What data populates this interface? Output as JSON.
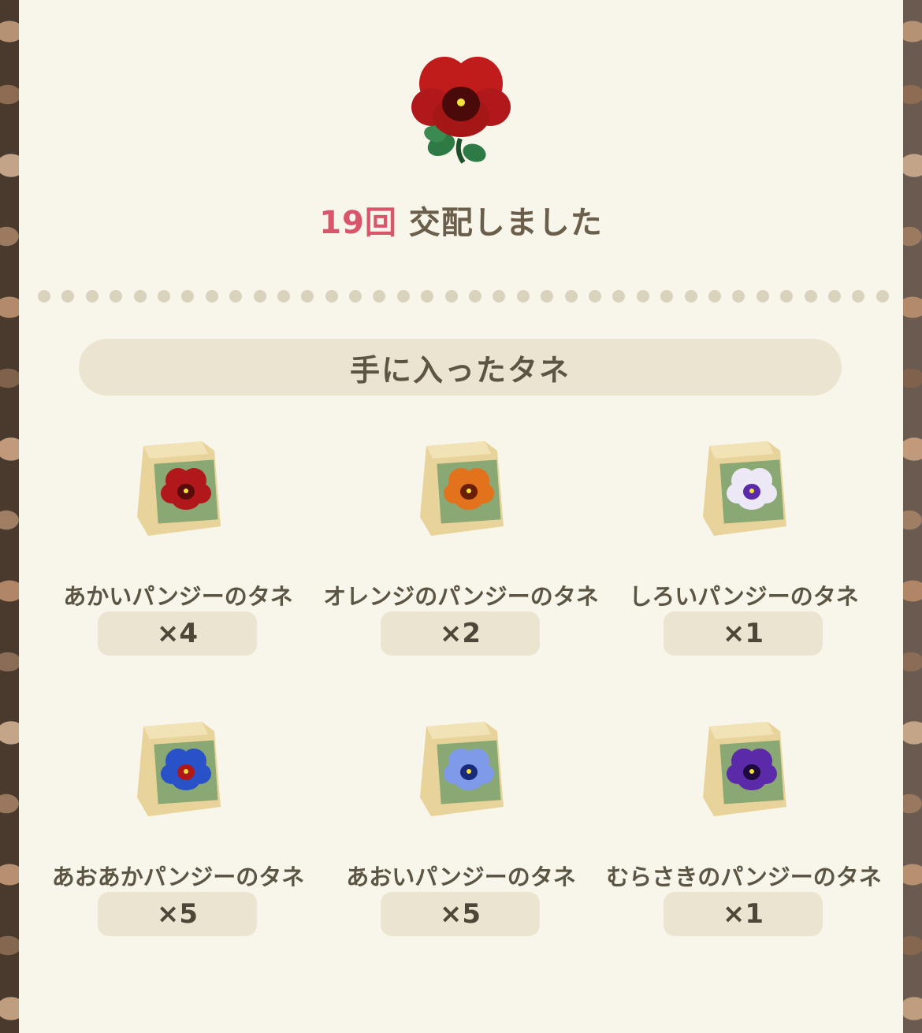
{
  "result": {
    "count": "19回",
    "message": "交配しました",
    "flower_icon": "red-pansy-icon"
  },
  "section": {
    "title": "手に入ったタネ"
  },
  "seeds": [
    {
      "name": "あかいパンジーのタネ",
      "qty": "×4",
      "icon": "red-pansy-seed-bag-icon",
      "petal": "#b0181c",
      "inner": "#5a0c0c"
    },
    {
      "name": "オレンジのパンジーのタネ",
      "qty": "×2",
      "icon": "orange-pansy-seed-bag-icon",
      "petal": "#e2721c",
      "inner": "#6a1e08"
    },
    {
      "name": "しろいパンジーのタネ",
      "qty": "×1",
      "icon": "white-pansy-seed-bag-icon",
      "petal": "#ece8f6",
      "inner": "#5a2aa8"
    },
    {
      "name": "あおあかパンジーのタネ",
      "qty": "×5",
      "icon": "blue-red-pansy-seed-bag-icon",
      "petal": "#2a52c8",
      "inner": "#b01818"
    },
    {
      "name": "あおいパンジーのタネ",
      "qty": "×5",
      "icon": "blue-pansy-seed-bag-icon",
      "petal": "#7e9ae8",
      "inner": "#1a2a7a"
    },
    {
      "name": "むらさきのパンジーのタネ",
      "qty": "×1",
      "icon": "purple-pansy-seed-bag-icon",
      "petal": "#5a2aa8",
      "inner": "#1e0a3e"
    }
  ]
}
